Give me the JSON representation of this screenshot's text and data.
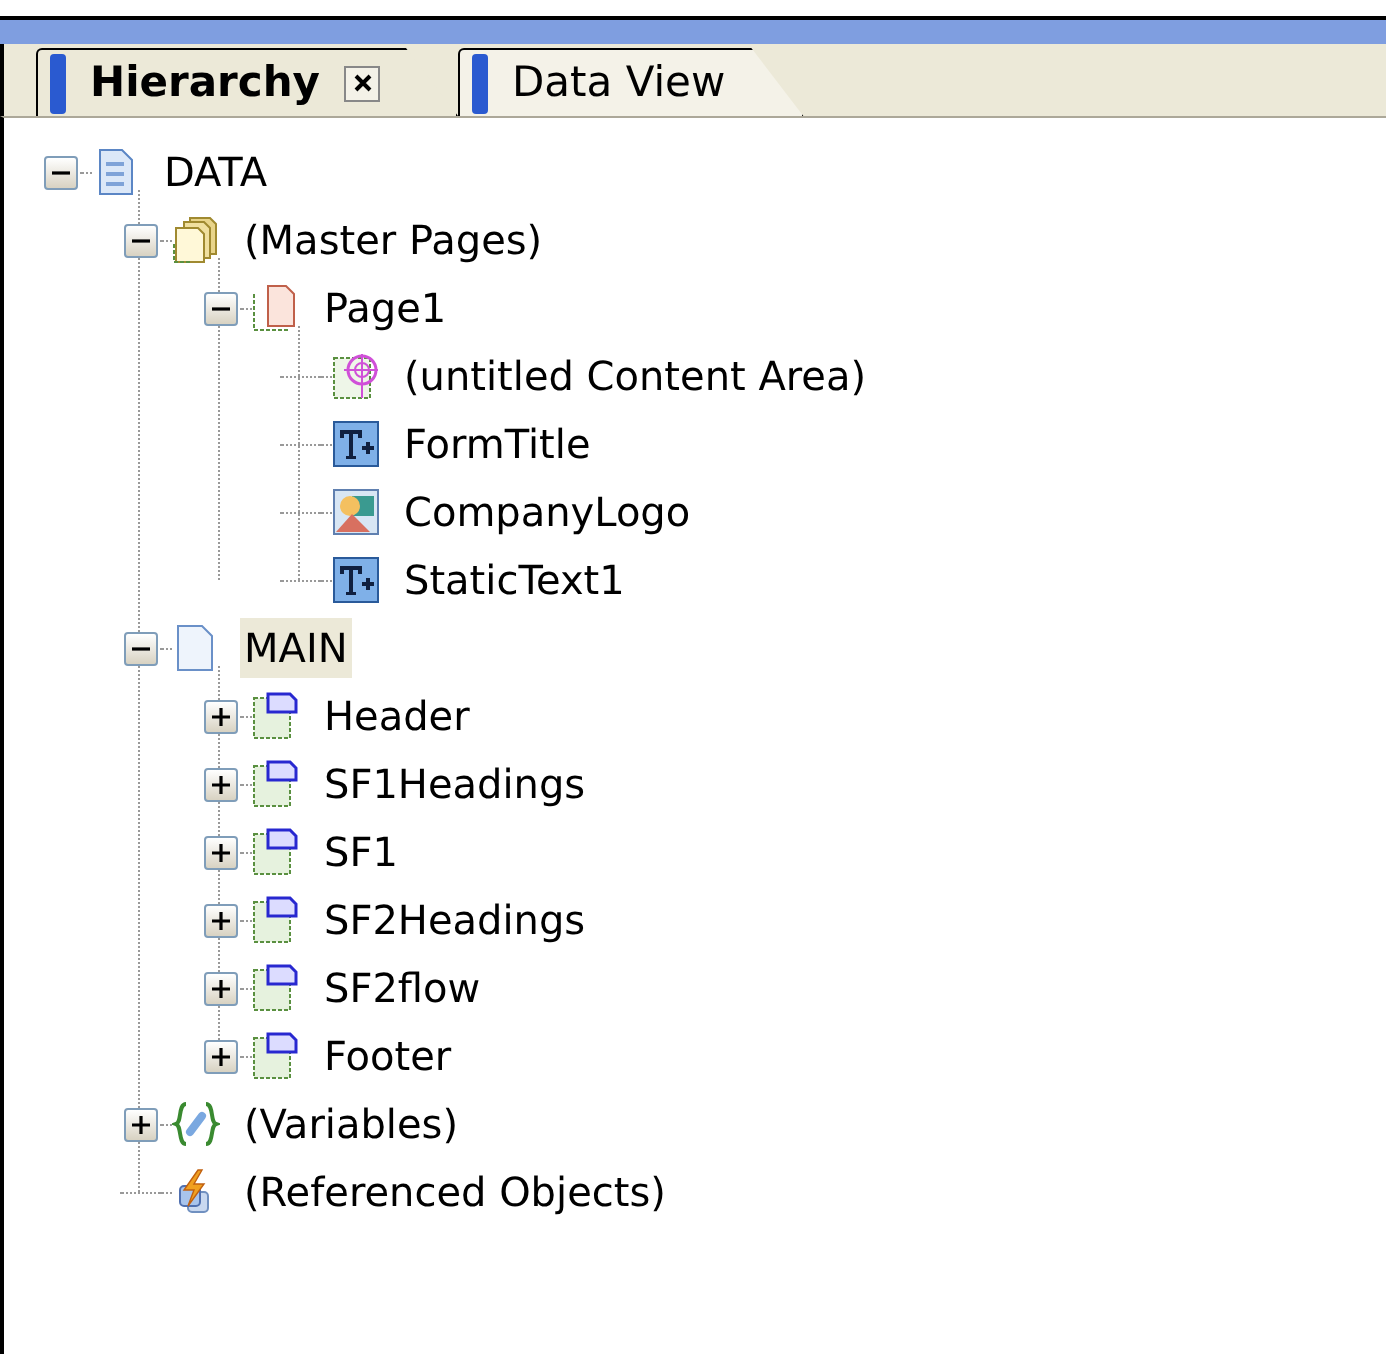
{
  "tabs": [
    {
      "label": "Hierarchy",
      "selected": true,
      "closable": true
    },
    {
      "label": "Data View",
      "selected": false,
      "closable": false
    }
  ],
  "tree": [
    {
      "label": "DATA",
      "kind": "document",
      "expanded": true,
      "selected": false,
      "children": [
        {
          "label": "(Master Pages)",
          "kind": "pages",
          "expanded": true,
          "selected": false,
          "children": [
            {
              "label": "Page1",
              "kind": "page",
              "expanded": true,
              "selected": false,
              "children": [
                {
                  "label": "(untitled Content Area)",
                  "kind": "content-area",
                  "selected": false
                },
                {
                  "label": "FormTitle",
                  "kind": "text",
                  "selected": false
                },
                {
                  "label": "CompanyLogo",
                  "kind": "image",
                  "selected": false
                },
                {
                  "label": "StaticText1",
                  "kind": "text",
                  "selected": false
                }
              ]
            }
          ]
        },
        {
          "label": "MAIN",
          "kind": "subform-page",
          "expanded": true,
          "selected": true,
          "children": [
            {
              "label": "Header",
              "kind": "subform",
              "expanded": false,
              "selected": false
            },
            {
              "label": "SF1Headings",
              "kind": "subform",
              "expanded": false,
              "selected": false
            },
            {
              "label": "SF1",
              "kind": "subform",
              "expanded": false,
              "selected": false
            },
            {
              "label": "SF2Headings",
              "kind": "subform",
              "expanded": false,
              "selected": false
            },
            {
              "label": "SF2flow",
              "kind": "subform",
              "expanded": false,
              "selected": false
            },
            {
              "label": "Footer",
              "kind": "subform",
              "expanded": false,
              "selected": false
            }
          ]
        },
        {
          "label": "(Variables)",
          "kind": "variables",
          "expanded": false,
          "selected": false
        },
        {
          "label": "(Referenced Objects)",
          "kind": "referenced",
          "selected": false
        }
      ]
    }
  ]
}
